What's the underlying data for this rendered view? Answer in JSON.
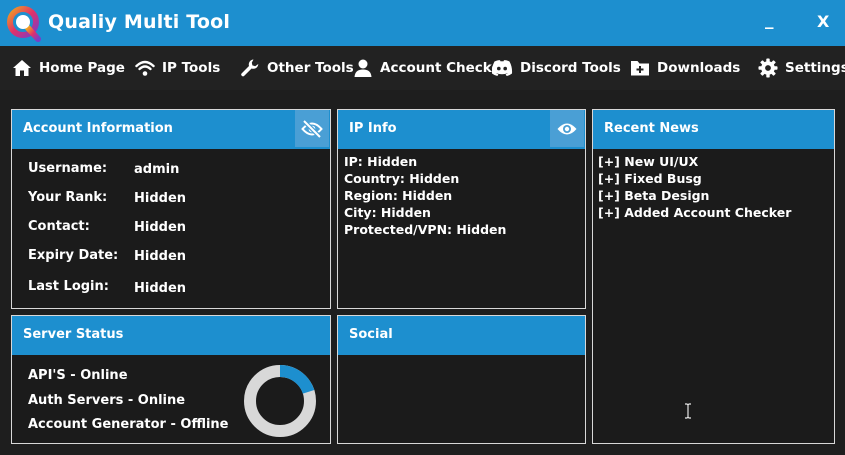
{
  "app": {
    "title": "Qualiy Multi Tool",
    "minimize_label": "_",
    "close_label": "X"
  },
  "nav": {
    "items": [
      {
        "label": "Home Page",
        "icon": "home-icon"
      },
      {
        "label": "IP  Tools",
        "icon": "wifi-icon"
      },
      {
        "label": "Other Tools",
        "icon": "wrench-icon"
      },
      {
        "label": "Account Checker",
        "icon": "user-icon"
      },
      {
        "label": "Discord Tools",
        "icon": "discord-icon"
      },
      {
        "label": "Downloads",
        "icon": "folder-add-icon"
      },
      {
        "label": "Settings",
        "icon": "gear-icon"
      }
    ]
  },
  "account": {
    "title": "Account Information",
    "rows": [
      {
        "label": "Username:",
        "value": "admin"
      },
      {
        "label": "Your Rank:",
        "value": "Hidden"
      },
      {
        "label": "Contact:",
        "value": "Hidden"
      },
      {
        "label": "Expiry Date:",
        "value": "Hidden"
      },
      {
        "label": "Last Login:",
        "value": "Hidden"
      }
    ]
  },
  "ip_info": {
    "title": "IP Info",
    "lines": [
      "IP: Hidden",
      "Country: Hidden",
      "Region: Hidden",
      "City: Hidden",
      "Protected/VPN: Hidden"
    ]
  },
  "news": {
    "title": "Recent News",
    "items": [
      "[+] New UI/UX",
      "[+] Fixed Busg",
      "[+] Beta Design",
      "[+] Added Account Checker"
    ]
  },
  "server": {
    "title": "Server Status",
    "lines": [
      "API'S - Online",
      "Auth Servers - Online",
      "Account Generator - Offline"
    ],
    "online_fraction": 0.2
  },
  "social": {
    "title": "Social"
  },
  "colors": {
    "accent": "#1d8fcf",
    "background": "#1e1e1e",
    "donut_track": "#d8d8d8"
  }
}
